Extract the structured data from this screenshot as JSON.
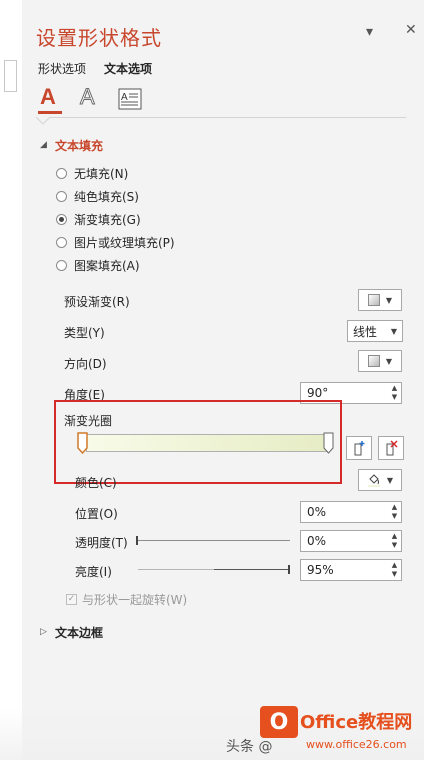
{
  "window": {
    "title": "设置形状格式",
    "menu_glyph": "▾",
    "close_glyph": "✕"
  },
  "tabs": [
    {
      "label": "形状选项"
    },
    {
      "label": "文本选项"
    }
  ],
  "icon_tabs": [
    {
      "glyph": "A"
    },
    {
      "glyph": "A"
    }
  ],
  "text_fill": {
    "heading": "文本填充",
    "options": [
      {
        "label": "无填充(N)",
        "checked": false
      },
      {
        "label": "纯色填充(S)",
        "checked": false
      },
      {
        "label": "渐变填充(G)",
        "checked": true
      },
      {
        "label": "图片或纹理填充(P)",
        "checked": false
      },
      {
        "label": "图案填充(A)",
        "checked": false
      }
    ],
    "preset_label": "预设渐变(R)",
    "type_label": "类型(Y)",
    "type_value": "线性",
    "direction_label": "方向(D)",
    "angle_label": "角度(E)",
    "angle_value": "90°",
    "stops_label": "渐变光圈",
    "color_label": "颜色(C)",
    "position_label": "位置(O)",
    "position_value": "0%",
    "transparency_label": "透明度(T)",
    "transparency_value": "0%",
    "brightness_label": "亮度(I)",
    "brightness_value": "95%",
    "rotate_label": "与形状一起旋转(W)"
  },
  "text_border": {
    "heading": "文本边框"
  },
  "watermark": {
    "prefix": "头条 @",
    "site": "www.office26.com",
    "logo_letter": "O",
    "logo_text": "Office教程网"
  },
  "colors": {
    "accent": "#c8472c",
    "highlight": "#d42a2a",
    "gradient_start": "#f8fbe8",
    "gradient_end": "#e6ecc4"
  }
}
